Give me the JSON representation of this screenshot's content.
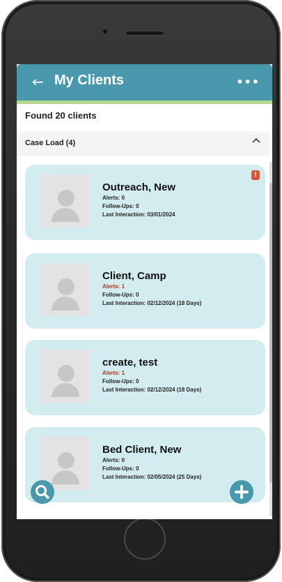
{
  "header": {
    "back_icon": "←",
    "title": "My Clients",
    "more_icon": "•••"
  },
  "summary": {
    "found_text": "Found 20 clients"
  },
  "section": {
    "label": "Case Load (4)",
    "chevron": "^"
  },
  "clients": [
    {
      "name": "Outreach, New",
      "alerts": "Alerts: 0",
      "followups": "Follow-Ups: 0",
      "last_interaction": "Last Interaction: 03/01/2024",
      "badge": "!"
    },
    {
      "name": "Client, Camp",
      "alerts": "Alerts: 1",
      "followups": "Follow-Ups: 0",
      "last_interaction": "Last Interaction: 02/12/2024 (18 Days)"
    },
    {
      "name": "create, test",
      "alerts": "Alerts: 1",
      "followups": "Follow-Ups: 0",
      "last_interaction": "Last Interaction: 02/12/2024 (18 Days)"
    },
    {
      "name": "Bed Client, New",
      "alerts": "Alerts: 0",
      "followups": "Follow-Ups: 0",
      "last_interaction": "Last Interaction: 02/05/2024 (25 Days)"
    }
  ],
  "colors": {
    "header_bg": "#4a98ad",
    "header_accent": "#b3d88c",
    "card_bg": "#d3ecef",
    "alert_red": "#a33a1f",
    "badge": "#d7553a"
  },
  "icons": {
    "search_fab": "search-icon",
    "add_fab": "plus-icon"
  }
}
